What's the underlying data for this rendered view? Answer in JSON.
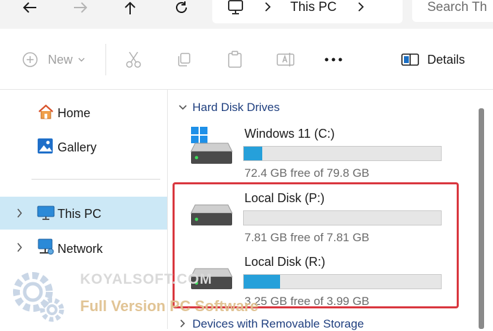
{
  "address_bar": {
    "back_icon": "arrow-left-icon",
    "forward_icon": "arrow-right-icon",
    "up_icon": "arrow-up-icon",
    "refresh_icon": "refresh-icon",
    "breadcrumb": [
      "This PC"
    ],
    "search_placeholder": "Search Th"
  },
  "toolbar": {
    "new_label": "New",
    "details_label": "Details"
  },
  "sidebar": {
    "items": [
      {
        "label": "Home",
        "icon": "home-icon"
      },
      {
        "label": "Gallery",
        "icon": "gallery-icon"
      },
      {
        "label": "This PC",
        "icon": "monitor-icon",
        "selected": true
      },
      {
        "label": "Network",
        "icon": "network-icon"
      }
    ]
  },
  "content": {
    "groups": [
      {
        "label": "Hard Disk Drives",
        "expanded": true
      },
      {
        "label": "Devices with Removable Storage",
        "expanded": false
      }
    ],
    "drives": [
      {
        "name": "Windows 11 (C:)",
        "free_text": "72.4 GB free of 79.8 GB",
        "used_fraction": 0.093
      },
      {
        "name": "Local Disk (P:)",
        "free_text": "7.81 GB free of 7.81 GB",
        "used_fraction": 0.0
      },
      {
        "name": "Local Disk (R:)",
        "free_text": "3.25 GB free of 3.99 GB",
        "used_fraction": 0.185
      }
    ]
  },
  "watermark": {
    "line1": "KOYALSOFT.COM",
    "line2": "Full Version PC Software"
  },
  "colors": {
    "accent": "#26a0da",
    "highlight": "#d9363e",
    "selection": "#cce8f6"
  }
}
